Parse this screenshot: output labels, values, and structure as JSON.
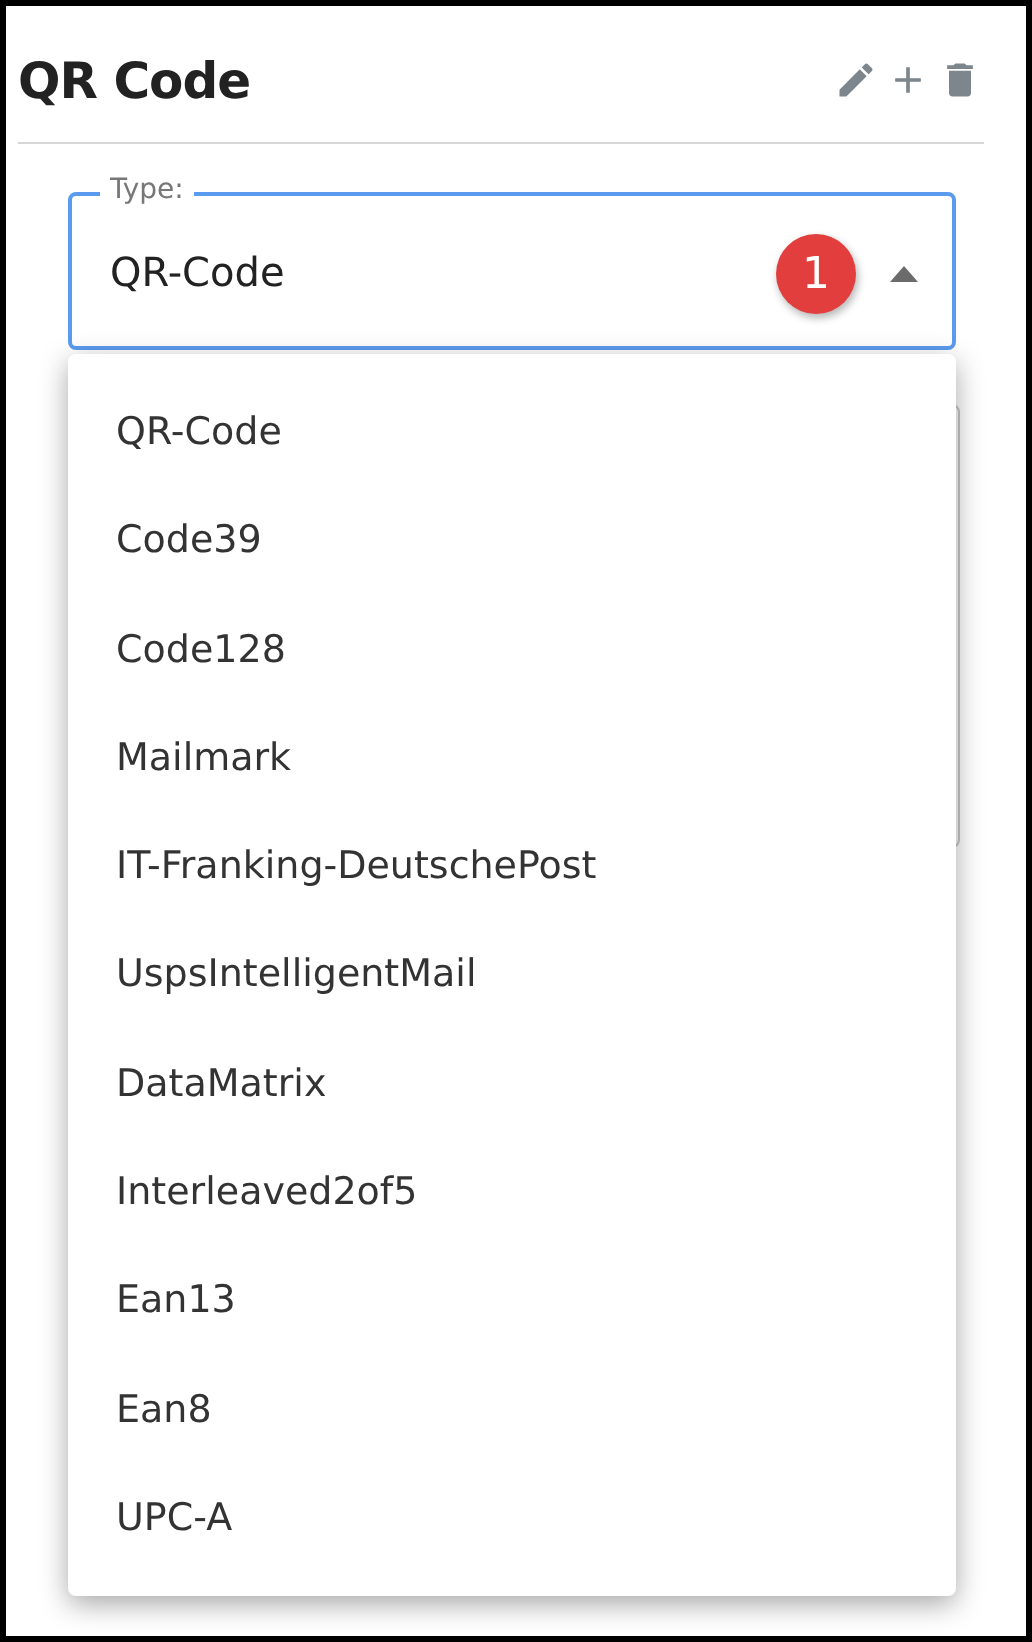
{
  "header": {
    "title": "QR Code"
  },
  "type_select": {
    "label": "Type:",
    "value": "QR-Code",
    "badge": "1",
    "expanded": true
  },
  "dropdown": {
    "options": [
      {
        "label": "QR-Code",
        "selected": false
      },
      {
        "label": "Code39",
        "selected": false
      },
      {
        "label": "Code128",
        "selected": false
      },
      {
        "label": "Mailmark",
        "selected": false
      },
      {
        "label": "IT-Franking-DeutschePost",
        "selected": false
      },
      {
        "label": "UspsIntelligentMail",
        "selected": false
      },
      {
        "label": "DataMatrix",
        "selected": false
      },
      {
        "label": "Interleaved2of5",
        "selected": false
      },
      {
        "label": "Ean13",
        "selected": false
      },
      {
        "label": "Ean8",
        "selected": false
      },
      {
        "label": "UPC-A",
        "selected": false
      }
    ]
  }
}
